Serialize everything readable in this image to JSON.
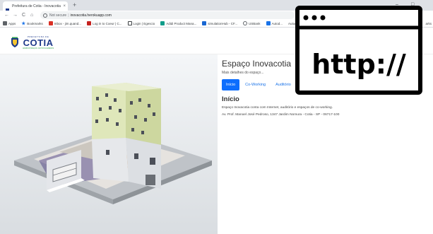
{
  "browser": {
    "tab_title": "Prefeitura de Cotia - Inovacotia",
    "tab_close": "×",
    "new_tab": "+",
    "win_minimize": "–",
    "win_maximize": "□",
    "nav_back": "←",
    "nav_forward": "→",
    "nav_reload": "C",
    "nav_home": "⌂",
    "security_label": "Not secure",
    "separator": "|",
    "url": "inovacotia.herokuapp.com"
  },
  "bookmarks": [
    {
      "label": "Apps",
      "icon": "apps-grid-icon",
      "color": "#5f6368"
    },
    {
      "label": "Bookmarks",
      "icon": "star-icon",
      "color": "#1a73e8"
    },
    {
      "label": "Inbox - jim.quand...",
      "icon": "gmail-icon",
      "color": "#d93025"
    },
    {
      "label": "Log in to Coeur | C...",
      "icon": "red-site-icon",
      "color": "#c5221f"
    },
    {
      "label": "Login | Egescio",
      "icon": "check-icon",
      "color": "#3c4043"
    },
    {
      "label": "Adidi Product Mana...",
      "icon": "teal-icon",
      "color": "#0f9d8a"
    },
    {
      "label": "simulationHub - CF...",
      "icon": "blue-square-icon",
      "color": "#1967d2"
    },
    {
      "label": "USBank",
      "icon": "globe-icon",
      "color": "#5f6368"
    },
    {
      "label": "Autod...",
      "icon": "autodesk-icon",
      "color": "#1a73e8"
    }
  ],
  "bookmarks_overflow": "Autodesk Sta...",
  "bookmarks_right": "arks",
  "brand": {
    "small": "PREFEITURA DE",
    "main": "COTIA",
    "sub": "ADMINISTRAÇÃO JUNTOS FAZEMOS",
    "primary": "#1e3a8a",
    "accent": "#2ea34a"
  },
  "page": {
    "title": "Espaço Inovacotia",
    "subtitle": "Mais detalhes do espaço...",
    "tabs": [
      {
        "label": "Início",
        "active": true
      },
      {
        "label": "Co-Working",
        "active": false
      },
      {
        "label": "Auditório",
        "active": false
      }
    ],
    "section_title": "Início",
    "description": "Espaço Inovacotia conta com Internet, auditório e espaços de co-working.",
    "address": "Av. Prof. Manoel José Pedroso, 1347 Jardim Nomura - Cotia - SP - 06717-100"
  },
  "overlay": {
    "text": "http://",
    "icon": "browser-window-icon"
  },
  "colors": {
    "active_tab_bg": "#0d6efd",
    "link": "#1a73e8"
  }
}
